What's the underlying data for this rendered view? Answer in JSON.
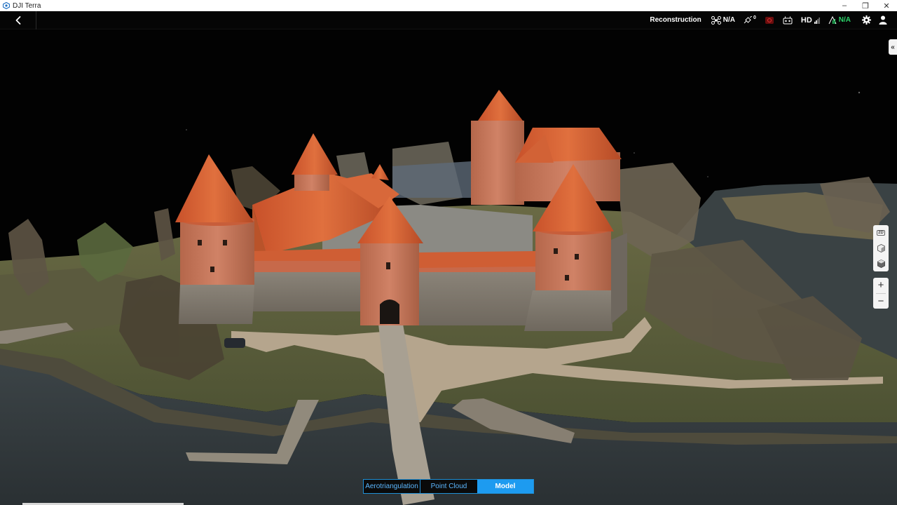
{
  "window": {
    "title": "DJI Terra",
    "minimize": "–",
    "restore": "❐",
    "close": "✕"
  },
  "toolbar": {
    "mode_label": "Reconstruction",
    "aircraft_status": "N/A",
    "gps_count": "0",
    "hd_label": "HD",
    "signal_status": "N/A",
    "icons": [
      "back-icon",
      "aircraft-icon",
      "satellite-icon",
      "rc-off-icon",
      "remote-controller-icon",
      "signal-icon",
      "settings-icon",
      "user-icon"
    ],
    "accent_color": "#2bd46a"
  },
  "viewtools": {
    "view_2d": "2D",
    "items": [
      "view-2d-icon",
      "view-3d-icon",
      "view-cube-icon"
    ],
    "zoom_in": "+",
    "zoom_out": "−"
  },
  "collapse_tab": "«",
  "modes": {
    "tabs": [
      {
        "label": "Aerotriangulation",
        "active": false
      },
      {
        "label": "Point Cloud",
        "active": false
      },
      {
        "label": "Model",
        "active": true
      }
    ],
    "active_color": "#1d9bf0"
  }
}
